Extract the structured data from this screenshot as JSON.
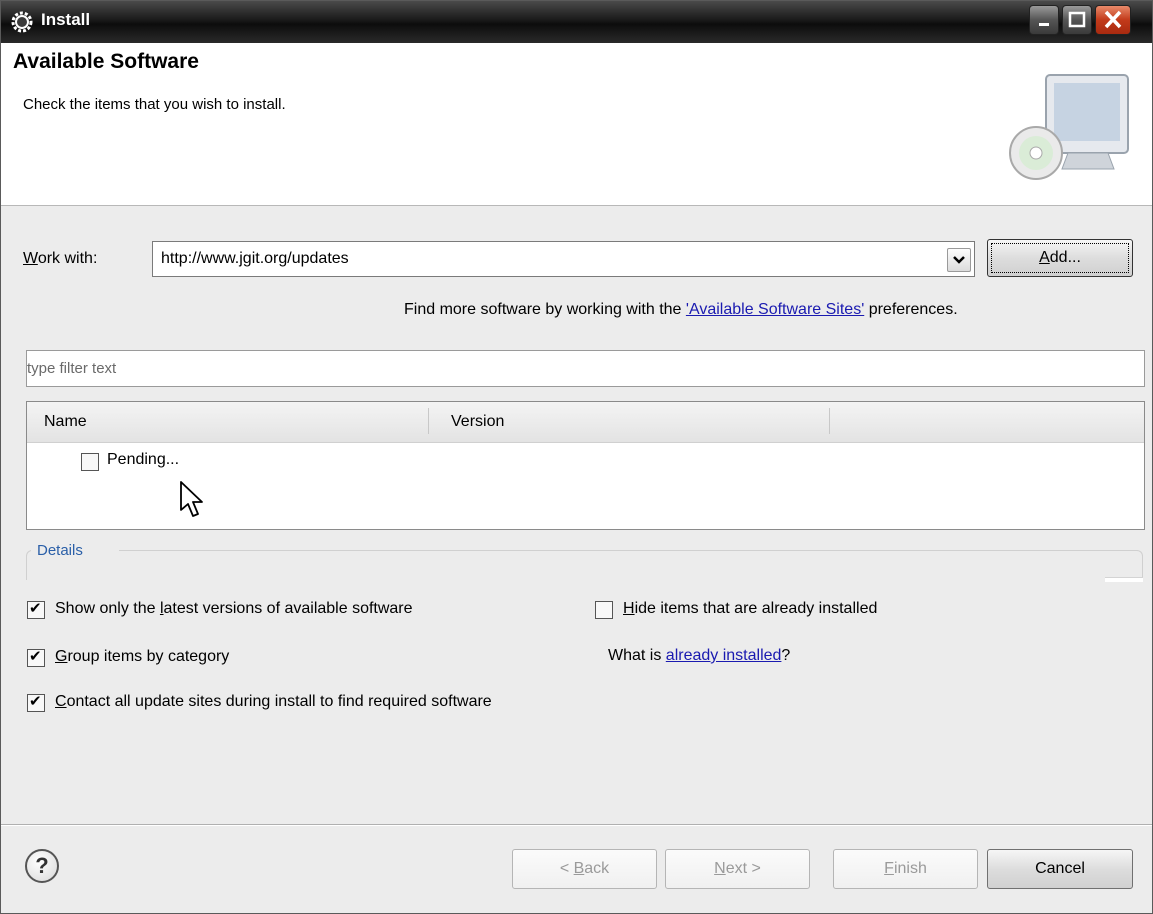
{
  "window": {
    "title": "Install"
  },
  "banner": {
    "title": "Available Software",
    "subtitle": "Check the items that you wish to install."
  },
  "work_with": {
    "label_mnemonic": "W",
    "label_rest": "ork with:",
    "value": "http://www.jgit.org/updates",
    "add_mnemonic": "A",
    "add_rest": "dd...",
    "hint_prefix": "Find more software by working with the ",
    "hint_link": "'Available Software Sites'",
    "hint_suffix": " preferences."
  },
  "filter": {
    "placeholder": "type filter text"
  },
  "table": {
    "columns": [
      "Name",
      "Version"
    ],
    "rows": [
      {
        "label": "Pending...",
        "checked": false
      }
    ]
  },
  "details": {
    "label": "Details"
  },
  "options": {
    "show_latest": {
      "pre": "Show only the ",
      "mn": "l",
      "post": "atest versions of available software",
      "checked": true
    },
    "hide_installed": {
      "pre": "",
      "mn": "H",
      "post": "ide items that are already installed",
      "checked": false
    },
    "group_by_category": {
      "pre": "",
      "mn": "G",
      "post": "roup items by category",
      "checked": true
    },
    "already_installed_prefix": "What is ",
    "already_installed_link": "already installed",
    "already_installed_suffix": "?",
    "contact_sites": {
      "pre": "",
      "mn": "C",
      "post": "ontact all update sites during install to find required software",
      "checked": true
    }
  },
  "buttons": {
    "back_pre": "< ",
    "back_mn": "B",
    "back_post": "ack",
    "next_mn": "N",
    "next_post": "ext >",
    "finish_mn": "F",
    "finish_post": "inish",
    "cancel": "Cancel"
  },
  "icons": {
    "window": "gear-icon",
    "banner": "computer-cd-icon",
    "help": "help-icon",
    "combo": "chevron-down-icon",
    "cursor": "mouse-cursor-icon"
  }
}
